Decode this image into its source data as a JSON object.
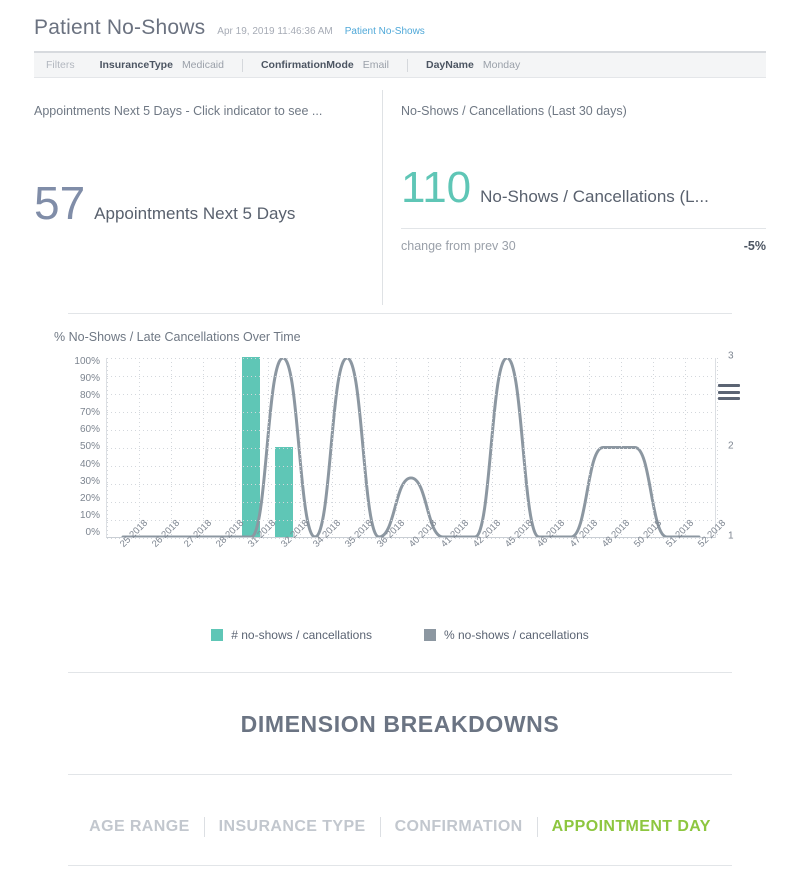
{
  "header": {
    "title": "Patient No-Shows",
    "timestamp": "Apr 19, 2019 11:46:36 AM",
    "link": "Patient No-Shows"
  },
  "filters": {
    "label": "Filters",
    "items": [
      {
        "key": "InsuranceType",
        "value": "Medicaid"
      },
      {
        "key": "ConfirmationMode",
        "value": "Email"
      },
      {
        "key": "DayName",
        "value": "Monday"
      }
    ]
  },
  "kpis": [
    {
      "caption": "Appointments Next 5 Days - Click indicator to see ...",
      "value": "57",
      "label": "Appointments Next 5 Days",
      "color": "#808da8"
    },
    {
      "caption": "No-Shows / Cancellations (Last 30 days)",
      "value": "110",
      "label": "No-Shows / Cancellations (L...",
      "color": "#5fc6b6",
      "footer_label": "change from prev 30",
      "footer_value": "-5%"
    }
  ],
  "chart_data": {
    "type": "bar",
    "title": "% No-Shows / Late Cancellations Over Time",
    "xlabel": "",
    "ylabel": "",
    "grid": true,
    "legend_position": "bottom",
    "categories": [
      "25 2018",
      "26 2018",
      "27 2018",
      "28 2018",
      "31 2018",
      "32 2018",
      "34 2018",
      "35 2018",
      "36 2018",
      "40 2018",
      "41 2018",
      "42 2018",
      "45 2018",
      "46 2018",
      "47 2018",
      "48 2018",
      "50 2018",
      "51 2018",
      "52 2018"
    ],
    "y_left_ticks": [
      "100%",
      "90%",
      "80%",
      "70%",
      "60%",
      "50%",
      "40%",
      "30%",
      "20%",
      "10%",
      "0%"
    ],
    "y_left_lim": [
      0,
      100
    ],
    "y_right_ticks": [
      "3",
      "2",
      "1"
    ],
    "y_right_lim": [
      1,
      3
    ],
    "series": [
      {
        "name": "# no-shows / cancellations",
        "type": "bar",
        "color": "#5fc6b6",
        "axis": "right",
        "values": [
          0,
          0,
          0,
          0,
          3,
          2,
          0,
          0,
          0,
          0,
          0,
          0,
          0,
          0,
          0,
          0,
          0,
          0,
          0
        ]
      },
      {
        "name": "% no-shows / cancellations",
        "type": "line",
        "color": "#8c97a1",
        "axis": "left",
        "values": [
          0,
          0,
          0,
          0,
          0,
          100,
          0,
          100,
          0,
          33,
          0,
          0,
          100,
          0,
          0,
          50,
          50,
          0,
          0
        ]
      }
    ]
  },
  "breakdowns": {
    "title": "DIMENSION BREAKDOWNS",
    "tabs": [
      {
        "label": "AGE RANGE",
        "active": false
      },
      {
        "label": "INSURANCE TYPE",
        "active": false
      },
      {
        "label": "CONFIRMATION",
        "active": false
      },
      {
        "label": "APPOINTMENT DAY",
        "active": true
      }
    ],
    "active_color": "#8dc63f"
  }
}
